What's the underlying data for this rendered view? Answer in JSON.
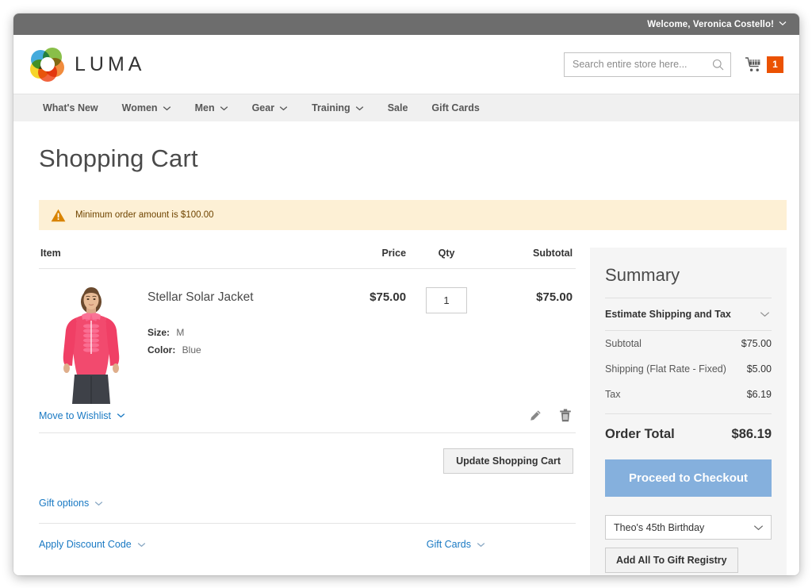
{
  "topbar": {
    "welcome": "Welcome, Veronica Costello!"
  },
  "header": {
    "logo_text": "LUMA",
    "search_placeholder": "Search entire store here...",
    "search_value": "",
    "cart_count": "1"
  },
  "nav": {
    "items": [
      {
        "label": "What's New",
        "has_caret": false
      },
      {
        "label": "Women",
        "has_caret": true
      },
      {
        "label": "Men",
        "has_caret": true
      },
      {
        "label": "Gear",
        "has_caret": true
      },
      {
        "label": "Training",
        "has_caret": true
      },
      {
        "label": "Sale",
        "has_caret": false
      },
      {
        "label": "Gift Cards",
        "has_caret": false
      }
    ]
  },
  "page": {
    "title": "Shopping Cart",
    "warning": "Minimum order amount is $100.00"
  },
  "cart": {
    "headers": {
      "item": "Item",
      "price": "Price",
      "qty": "Qty",
      "subtotal": "Subtotal"
    },
    "rows": [
      {
        "name": "Stellar Solar Jacket",
        "option_size_label": "Size:",
        "option_size_value": "M",
        "option_color_label": "Color:",
        "option_color_value": "Blue",
        "price": "$75.00",
        "qty": "1",
        "subtotal": "$75.00"
      }
    ],
    "move_to_wishlist": "Move to Wishlist",
    "update_button": "Update Shopping Cart",
    "gift_options": "Gift options",
    "apply_discount": "Apply Discount Code",
    "gift_cards": "Gift Cards"
  },
  "summary": {
    "title": "Summary",
    "estimate_label": "Estimate Shipping and Tax",
    "lines": [
      {
        "label": "Subtotal",
        "amount": "$75.00"
      },
      {
        "label": "Shipping (Flat Rate - Fixed)",
        "amount": "$5.00"
      },
      {
        "label": "Tax",
        "amount": "$6.19"
      }
    ],
    "order_total_label": "Order Total",
    "order_total_amount": "$86.19",
    "checkout_button": "Proceed to Checkout",
    "registry_selected": "Theo's 45th Birthday",
    "registry_button": "Add All To Gift Registry"
  },
  "colors": {
    "accent_orange": "#eb5202",
    "link_blue": "#1979c3",
    "checkout_blue": "#85b0dd",
    "warning_bg": "#fdf0d5",
    "warning_text": "#6f4400",
    "topbar_gray": "#6d6d6d",
    "nav_gray": "#f0f0f0",
    "summary_gray": "#f5f5f5"
  }
}
